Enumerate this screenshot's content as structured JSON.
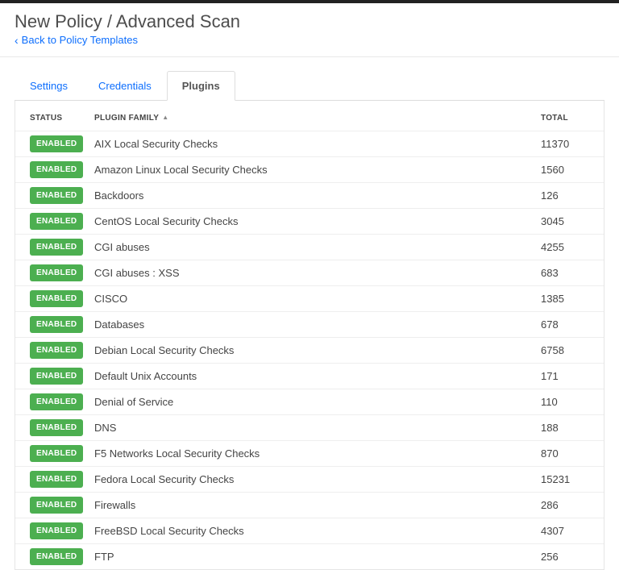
{
  "header": {
    "title": "New Policy / Advanced Scan",
    "back_label": "Back to Policy Templates"
  },
  "tabs": {
    "settings": "Settings",
    "credentials": "Credentials",
    "plugins": "Plugins"
  },
  "columns": {
    "status": "STATUS",
    "family": "PLUGIN FAMILY",
    "total": "TOTAL"
  },
  "status_label": "ENABLED",
  "rows": [
    {
      "family": "AIX Local Security Checks",
      "total": "11370"
    },
    {
      "family": "Amazon Linux Local Security Checks",
      "total": "1560"
    },
    {
      "family": "Backdoors",
      "total": "126"
    },
    {
      "family": "CentOS Local Security Checks",
      "total": "3045"
    },
    {
      "family": "CGI abuses",
      "total": "4255"
    },
    {
      "family": "CGI abuses : XSS",
      "total": "683"
    },
    {
      "family": "CISCO",
      "total": "1385"
    },
    {
      "family": "Databases",
      "total": "678"
    },
    {
      "family": "Debian Local Security Checks",
      "total": "6758"
    },
    {
      "family": "Default Unix Accounts",
      "total": "171"
    },
    {
      "family": "Denial of Service",
      "total": "110"
    },
    {
      "family": "DNS",
      "total": "188"
    },
    {
      "family": "F5 Networks Local Security Checks",
      "total": "870"
    },
    {
      "family": "Fedora Local Security Checks",
      "total": "15231"
    },
    {
      "family": "Firewalls",
      "total": "286"
    },
    {
      "family": "FreeBSD Local Security Checks",
      "total": "4307"
    },
    {
      "family": "FTP",
      "total": "256"
    }
  ]
}
